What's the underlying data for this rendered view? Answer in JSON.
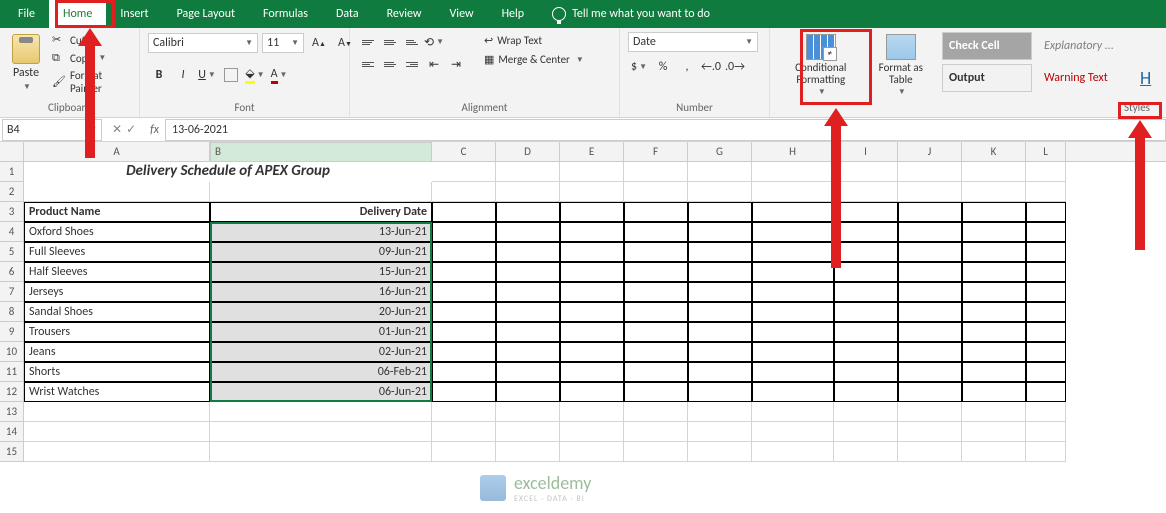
{
  "menu": {
    "file": "File",
    "home": "Home",
    "insert": "Insert",
    "pageLayout": "Page Layout",
    "formulas": "Formulas",
    "data": "Data",
    "review": "Review",
    "view": "View",
    "help": "Help",
    "tellme": "Tell me what you want to do"
  },
  "clipboard": {
    "paste": "Paste",
    "cut": "Cut",
    "copy": "Copy",
    "fmtPainter": "Format Painter",
    "label": "Clipboard"
  },
  "font": {
    "name": "Calibri",
    "size": "11",
    "label": "Font"
  },
  "alignment": {
    "wrap": "Wrap Text",
    "merge": "Merge & Center",
    "label": "Alignment"
  },
  "number": {
    "format": "Date",
    "label": "Number"
  },
  "styles": {
    "condFmt": "Conditional Formatting",
    "fmtTable": "Format as Table",
    "checkCell": "Check Cell",
    "explanatory": "Explanatory ...",
    "output": "Output",
    "warning": "Warning Text",
    "label": "Styles"
  },
  "fbar": {
    "name": "B4",
    "value": "13-06-2021"
  },
  "cols": [
    "A",
    "B",
    "C",
    "D",
    "E",
    "F",
    "G",
    "H",
    "I",
    "J",
    "K",
    "L"
  ],
  "title": "Delivery Schedule of APEX Group",
  "headers": {
    "a": "Product Name",
    "b": "Delivery Date"
  },
  "rows": [
    {
      "a": "Oxford Shoes",
      "b": "13-Jun-21"
    },
    {
      "a": "Full Sleeves",
      "b": "09-Jun-21"
    },
    {
      "a": "Half Sleeves",
      "b": "15-Jun-21"
    },
    {
      "a": "Jerseys",
      "b": "16-Jun-21"
    },
    {
      "a": "Sandal Shoes",
      "b": "20-Jun-21"
    },
    {
      "a": "Trousers",
      "b": "01-Jun-21"
    },
    {
      "a": "Jeans",
      "b": "02-Jun-21"
    },
    {
      "a": "Shorts",
      "b": "06-Feb-21"
    },
    {
      "a": "Wrist Watches",
      "b": "06-Jun-21"
    }
  ],
  "wm": {
    "brand": "exceldemy",
    "tag": "EXCEL · DATA · BI"
  }
}
